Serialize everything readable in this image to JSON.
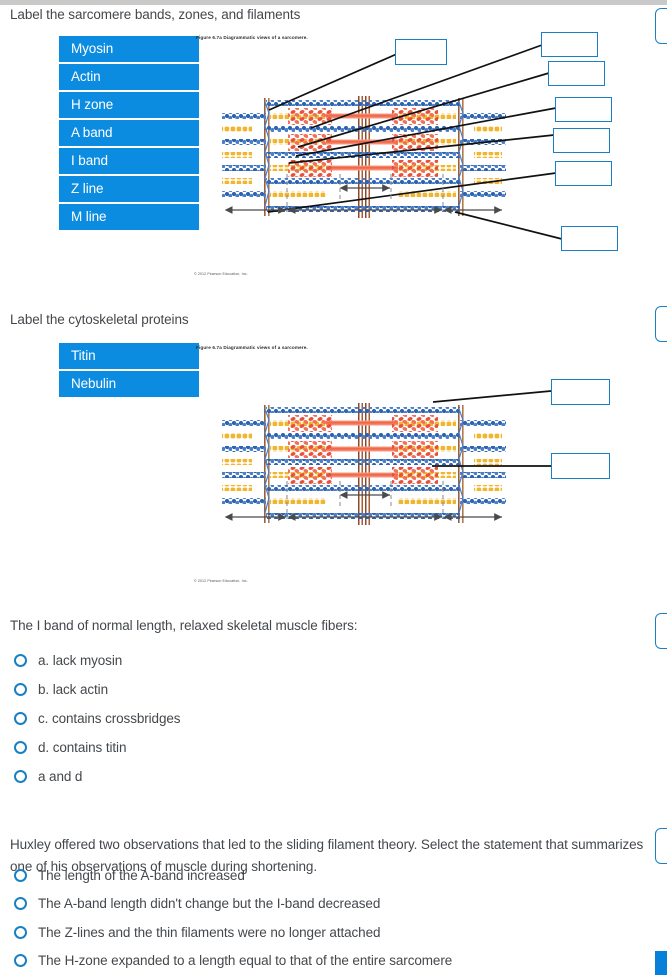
{
  "section1": {
    "prompt": "Label the sarcomere bands, zones, and filaments",
    "chips": [
      {
        "label": "Myosin"
      },
      {
        "label": "Actin"
      },
      {
        "label": "H zone"
      },
      {
        "label": "A band"
      },
      {
        "label": "I band"
      },
      {
        "label": "Z line"
      },
      {
        "label": "M line"
      }
    ],
    "figure": {
      "caption": "Figure 6.7a  Diagrammatic views of a sarcomere.",
      "copyright": "© 2012 Pearson Education, Inc."
    },
    "dropboxes": [
      {
        "value": ""
      },
      {
        "value": ""
      },
      {
        "value": ""
      },
      {
        "value": ""
      },
      {
        "value": ""
      },
      {
        "value": ""
      },
      {
        "value": ""
      }
    ]
  },
  "section2": {
    "prompt": "Label the cytoskeletal proteins",
    "chips": [
      {
        "label": "Titin"
      },
      {
        "label": "Nebulin"
      }
    ],
    "figure": {
      "caption": "Figure 6.7a  Diagrammatic views of a sarcomere.",
      "copyright": "© 2012 Pearson Education, Inc."
    },
    "dropboxes": [
      {
        "value": ""
      },
      {
        "value": ""
      }
    ]
  },
  "question3": {
    "prompt": "The I band of normal length, relaxed skeletal muscle fibers:",
    "options": [
      {
        "label": "a. lack myosin",
        "selected": false
      },
      {
        "label": "b. lack actin",
        "selected": false
      },
      {
        "label": "c. contains crossbridges",
        "selected": false
      },
      {
        "label": "d. contains titin",
        "selected": false
      },
      {
        "label": "a and d",
        "selected": false
      }
    ]
  },
  "question4": {
    "prompt_line1": "Huxley offered two observations that led to the sliding filament theory. Select the statement that summarizes",
    "prompt_line2": "one of his observations of muscle during shortening.",
    "options": [
      {
        "label": "The length of the A-band increased",
        "selected": false
      },
      {
        "label": "The A-band length didn't change but the I-band decreased",
        "selected": false
      },
      {
        "label": "The Z-lines and the thin filaments were no longer attached",
        "selected": false
      },
      {
        "label": "The H-zone expanded to a length equal to that of the entire sarcomere",
        "selected": false
      }
    ]
  },
  "colors": {
    "chip_blue": "#0c8ce0",
    "outline_blue": "#1b7fc4",
    "text_gray": "#44484c",
    "actin_blue": "#2e63b0",
    "myosin_red": "#f0735d",
    "gold": "#f2b52e",
    "zline_brown": "#9a5f3a"
  }
}
